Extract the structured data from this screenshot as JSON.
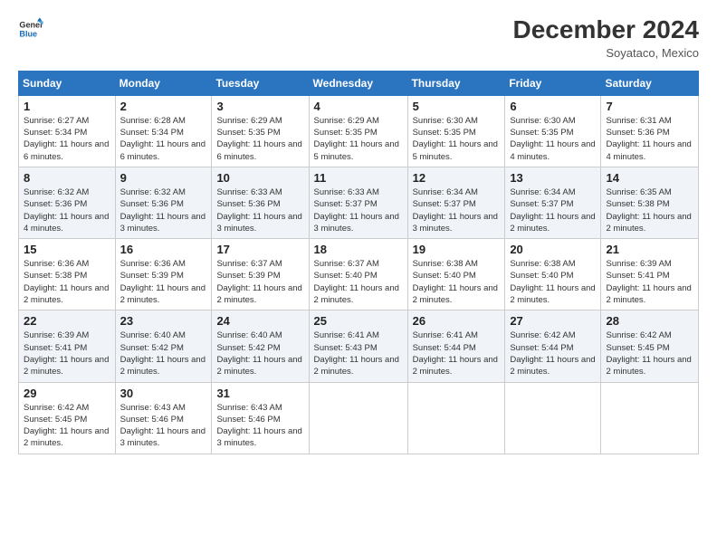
{
  "logo": {
    "line1": "General",
    "line2": "Blue",
    "alt": "GeneralBlue logo"
  },
  "title": "December 2024",
  "subtitle": "Soyataco, Mexico",
  "headers": [
    "Sunday",
    "Monday",
    "Tuesday",
    "Wednesday",
    "Thursday",
    "Friday",
    "Saturday"
  ],
  "weeks": [
    [
      {
        "day": "1",
        "sunrise": "Sunrise: 6:27 AM",
        "sunset": "Sunset: 5:34 PM",
        "daylight": "Daylight: 11 hours and 6 minutes."
      },
      {
        "day": "2",
        "sunrise": "Sunrise: 6:28 AM",
        "sunset": "Sunset: 5:34 PM",
        "daylight": "Daylight: 11 hours and 6 minutes."
      },
      {
        "day": "3",
        "sunrise": "Sunrise: 6:29 AM",
        "sunset": "Sunset: 5:35 PM",
        "daylight": "Daylight: 11 hours and 6 minutes."
      },
      {
        "day": "4",
        "sunrise": "Sunrise: 6:29 AM",
        "sunset": "Sunset: 5:35 PM",
        "daylight": "Daylight: 11 hours and 5 minutes."
      },
      {
        "day": "5",
        "sunrise": "Sunrise: 6:30 AM",
        "sunset": "Sunset: 5:35 PM",
        "daylight": "Daylight: 11 hours and 5 minutes."
      },
      {
        "day": "6",
        "sunrise": "Sunrise: 6:30 AM",
        "sunset": "Sunset: 5:35 PM",
        "daylight": "Daylight: 11 hours and 4 minutes."
      },
      {
        "day": "7",
        "sunrise": "Sunrise: 6:31 AM",
        "sunset": "Sunset: 5:36 PM",
        "daylight": "Daylight: 11 hours and 4 minutes."
      }
    ],
    [
      {
        "day": "8",
        "sunrise": "Sunrise: 6:32 AM",
        "sunset": "Sunset: 5:36 PM",
        "daylight": "Daylight: 11 hours and 4 minutes."
      },
      {
        "day": "9",
        "sunrise": "Sunrise: 6:32 AM",
        "sunset": "Sunset: 5:36 PM",
        "daylight": "Daylight: 11 hours and 3 minutes."
      },
      {
        "day": "10",
        "sunrise": "Sunrise: 6:33 AM",
        "sunset": "Sunset: 5:36 PM",
        "daylight": "Daylight: 11 hours and 3 minutes."
      },
      {
        "day": "11",
        "sunrise": "Sunrise: 6:33 AM",
        "sunset": "Sunset: 5:37 PM",
        "daylight": "Daylight: 11 hours and 3 minutes."
      },
      {
        "day": "12",
        "sunrise": "Sunrise: 6:34 AM",
        "sunset": "Sunset: 5:37 PM",
        "daylight": "Daylight: 11 hours and 3 minutes."
      },
      {
        "day": "13",
        "sunrise": "Sunrise: 6:34 AM",
        "sunset": "Sunset: 5:37 PM",
        "daylight": "Daylight: 11 hours and 2 minutes."
      },
      {
        "day": "14",
        "sunrise": "Sunrise: 6:35 AM",
        "sunset": "Sunset: 5:38 PM",
        "daylight": "Daylight: 11 hours and 2 minutes."
      }
    ],
    [
      {
        "day": "15",
        "sunrise": "Sunrise: 6:36 AM",
        "sunset": "Sunset: 5:38 PM",
        "daylight": "Daylight: 11 hours and 2 minutes."
      },
      {
        "day": "16",
        "sunrise": "Sunrise: 6:36 AM",
        "sunset": "Sunset: 5:39 PM",
        "daylight": "Daylight: 11 hours and 2 minutes."
      },
      {
        "day": "17",
        "sunrise": "Sunrise: 6:37 AM",
        "sunset": "Sunset: 5:39 PM",
        "daylight": "Daylight: 11 hours and 2 minutes."
      },
      {
        "day": "18",
        "sunrise": "Sunrise: 6:37 AM",
        "sunset": "Sunset: 5:40 PM",
        "daylight": "Daylight: 11 hours and 2 minutes."
      },
      {
        "day": "19",
        "sunrise": "Sunrise: 6:38 AM",
        "sunset": "Sunset: 5:40 PM",
        "daylight": "Daylight: 11 hours and 2 minutes."
      },
      {
        "day": "20",
        "sunrise": "Sunrise: 6:38 AM",
        "sunset": "Sunset: 5:40 PM",
        "daylight": "Daylight: 11 hours and 2 minutes."
      },
      {
        "day": "21",
        "sunrise": "Sunrise: 6:39 AM",
        "sunset": "Sunset: 5:41 PM",
        "daylight": "Daylight: 11 hours and 2 minutes."
      }
    ],
    [
      {
        "day": "22",
        "sunrise": "Sunrise: 6:39 AM",
        "sunset": "Sunset: 5:41 PM",
        "daylight": "Daylight: 11 hours and 2 minutes."
      },
      {
        "day": "23",
        "sunrise": "Sunrise: 6:40 AM",
        "sunset": "Sunset: 5:42 PM",
        "daylight": "Daylight: 11 hours and 2 minutes."
      },
      {
        "day": "24",
        "sunrise": "Sunrise: 6:40 AM",
        "sunset": "Sunset: 5:42 PM",
        "daylight": "Daylight: 11 hours and 2 minutes."
      },
      {
        "day": "25",
        "sunrise": "Sunrise: 6:41 AM",
        "sunset": "Sunset: 5:43 PM",
        "daylight": "Daylight: 11 hours and 2 minutes."
      },
      {
        "day": "26",
        "sunrise": "Sunrise: 6:41 AM",
        "sunset": "Sunset: 5:44 PM",
        "daylight": "Daylight: 11 hours and 2 minutes."
      },
      {
        "day": "27",
        "sunrise": "Sunrise: 6:42 AM",
        "sunset": "Sunset: 5:44 PM",
        "daylight": "Daylight: 11 hours and 2 minutes."
      },
      {
        "day": "28",
        "sunrise": "Sunrise: 6:42 AM",
        "sunset": "Sunset: 5:45 PM",
        "daylight": "Daylight: 11 hours and 2 minutes."
      }
    ],
    [
      {
        "day": "29",
        "sunrise": "Sunrise: 6:42 AM",
        "sunset": "Sunset: 5:45 PM",
        "daylight": "Daylight: 11 hours and 2 minutes."
      },
      {
        "day": "30",
        "sunrise": "Sunrise: 6:43 AM",
        "sunset": "Sunset: 5:46 PM",
        "daylight": "Daylight: 11 hours and 3 minutes."
      },
      {
        "day": "31",
        "sunrise": "Sunrise: 6:43 AM",
        "sunset": "Sunset: 5:46 PM",
        "daylight": "Daylight: 11 hours and 3 minutes."
      },
      null,
      null,
      null,
      null
    ]
  ]
}
